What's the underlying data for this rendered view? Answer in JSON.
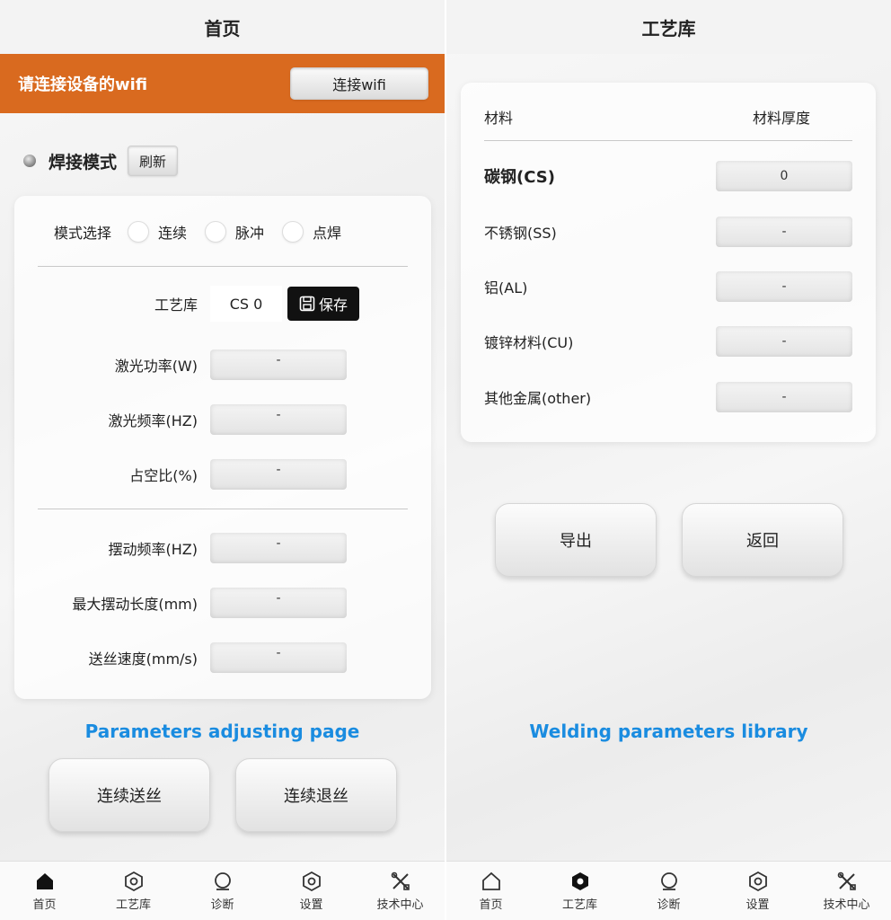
{
  "left": {
    "title": "首页",
    "wifi_banner": {
      "message": "请连接设备的wifi",
      "button": "连接wifi"
    },
    "weld_mode": {
      "title": "焊接模式",
      "refresh": "刷新"
    },
    "mode_select": {
      "label": "模式选择",
      "options": [
        "连续",
        "脉冲",
        "点焊"
      ]
    },
    "process_lib": {
      "label": "工艺库",
      "value": "CS 0",
      "save": "保存"
    },
    "params": [
      {
        "label": "激光功率(W)",
        "value": "-"
      },
      {
        "label": "激光频率(HZ)",
        "value": "-"
      },
      {
        "label": "占空比(%)",
        "value": "-"
      },
      {
        "label": "摆动频率(HZ)",
        "value": "-"
      },
      {
        "label": "最大摆动长度(mm)",
        "value": "-"
      },
      {
        "label": "送丝速度(mm/s)",
        "value": "-"
      }
    ],
    "caption": "Parameters adjusting page",
    "buttons": {
      "feed": "连续送丝",
      "retract": "连续退丝"
    }
  },
  "right": {
    "title": "工艺库",
    "header": {
      "material": "材料",
      "thickness": "材料厚度"
    },
    "materials": [
      {
        "name": "碳钢(CS)",
        "value": "0"
      },
      {
        "name": "不锈钢(SS)",
        "value": "-"
      },
      {
        "name": "铝(AL)",
        "value": "-"
      },
      {
        "name": "镀锌材料(CU)",
        "value": "-"
      },
      {
        "name": "其他金属(other)",
        "value": "-"
      }
    ],
    "buttons": {
      "export": "导出",
      "back": "返回"
    },
    "caption": "Welding parameters library"
  },
  "tabs": [
    "首页",
    "工艺库",
    "诊断",
    "设置",
    "技术中心"
  ],
  "icons": {
    "home": "home-icon",
    "library": "library-icon",
    "diagnose": "search-icon",
    "settings": "hexagon-nut-icon",
    "tech": "tools-icon",
    "save": "floppy-disk-icon"
  },
  "colors": {
    "banner": "#d96a1f",
    "caption": "#1a8ce0"
  }
}
